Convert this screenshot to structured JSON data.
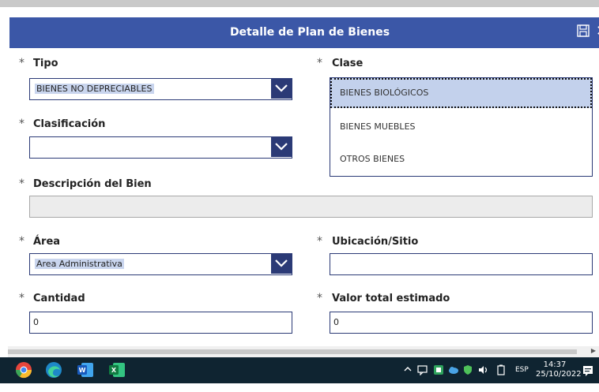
{
  "header": {
    "title": "Detalle de Plan de Bienes"
  },
  "form": {
    "tipo": {
      "label": "Tipo",
      "value": "BIENES NO DEPRECIABLES"
    },
    "clase": {
      "label": "Clase",
      "options": [
        "BIENES BIOLÓGICOS",
        "BIENES MUEBLES",
        "OTROS BIENES"
      ],
      "selected": "BIENES BIOLÓGICOS"
    },
    "clasificacion": {
      "label": "Clasificación",
      "value": ""
    },
    "descripcion": {
      "label": "Descripción del Bien",
      "value": ""
    },
    "area": {
      "label": "Área",
      "value": "Area Administrativa"
    },
    "ubicacion": {
      "label": "Ubicación/Sitio",
      "value": ""
    },
    "cantidad": {
      "label": "Cantidad",
      "value": "0"
    },
    "valor": {
      "label": "Valor total estimado",
      "value": "0"
    },
    "required_mark": "*"
  },
  "taskbar": {
    "apps": [
      "chrome-icon",
      "edge-icon",
      "word-icon",
      "excel-icon"
    ],
    "lang": "ESP",
    "time": "14:37",
    "date": "25/10/2022"
  },
  "colors": {
    "header": "#3b57a7",
    "accent": "#2b3a76",
    "selection": "#c3d1ec",
    "taskbar": "#0f2431"
  }
}
